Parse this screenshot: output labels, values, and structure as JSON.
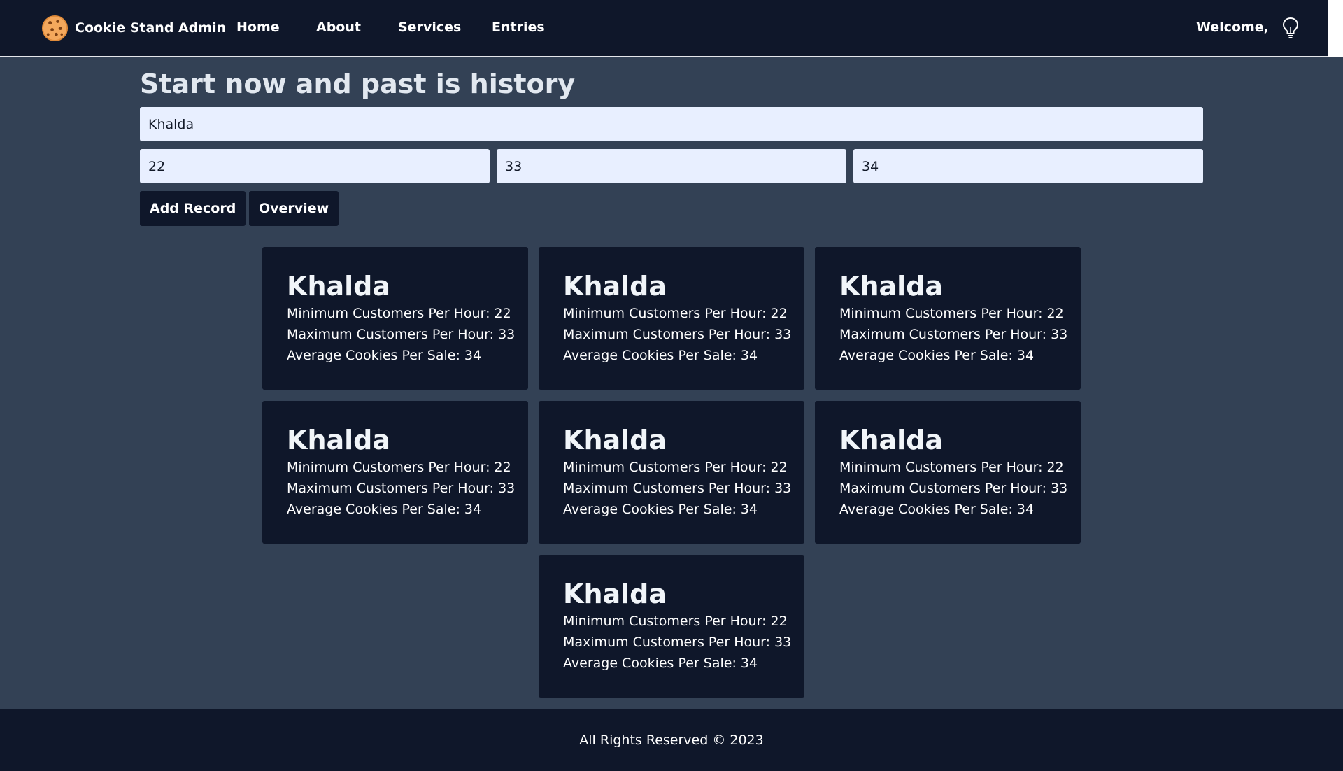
{
  "nav": {
    "brand": "Cookie Stand Admin",
    "links": [
      "Home",
      "About",
      "Services",
      "Entries"
    ],
    "welcome": "Welcome,",
    "brand_icon": "cookie-icon",
    "theme_icon": "lightbulb-icon"
  },
  "form": {
    "heading": "Start now and past is history",
    "location_value": "Khalda",
    "min_value": "22",
    "max_value": "33",
    "avg_value": "34",
    "add_label": "Add Record",
    "overview_label": "Overview"
  },
  "cards": [
    {
      "title": "Khalda",
      "min": "Minimum Customers Per Hour: 22",
      "max": "Maximum Customers Per Hour: 33",
      "avg": "Average Cookies Per Sale: 34"
    },
    {
      "title": "Khalda",
      "min": "Minimum Customers Per Hour: 22",
      "max": "Maximum Customers Per Hour: 33",
      "avg": "Average Cookies Per Sale: 34"
    },
    {
      "title": "Khalda",
      "min": "Minimum Customers Per Hour: 22",
      "max": "Maximum Customers Per Hour: 33",
      "avg": "Average Cookies Per Sale: 34"
    },
    {
      "title": "Khalda",
      "min": "Minimum Customers Per Hour: 22",
      "max": "Maximum Customers Per Hour: 33",
      "avg": "Average Cookies Per Sale: 34"
    },
    {
      "title": "Khalda",
      "min": "Minimum Customers Per Hour: 22",
      "max": "Maximum Customers Per Hour: 33",
      "avg": "Average Cookies Per Sale: 34"
    },
    {
      "title": "Khalda",
      "min": "Minimum Customers Per Hour: 22",
      "max": "Maximum Customers Per Hour: 33",
      "avg": "Average Cookies Per Sale: 34"
    },
    {
      "title": "Khalda",
      "min": "Minimum Customers Per Hour: 22",
      "max": "Maximum Customers Per Hour: 33",
      "avg": "Average Cookies Per Sale: 34"
    }
  ],
  "footer": {
    "text": "All Rights Reserved © 2023"
  },
  "colors": {
    "nav_bg": "#0f172a",
    "page_bg": "#334155",
    "input_bg": "#e8efff"
  }
}
